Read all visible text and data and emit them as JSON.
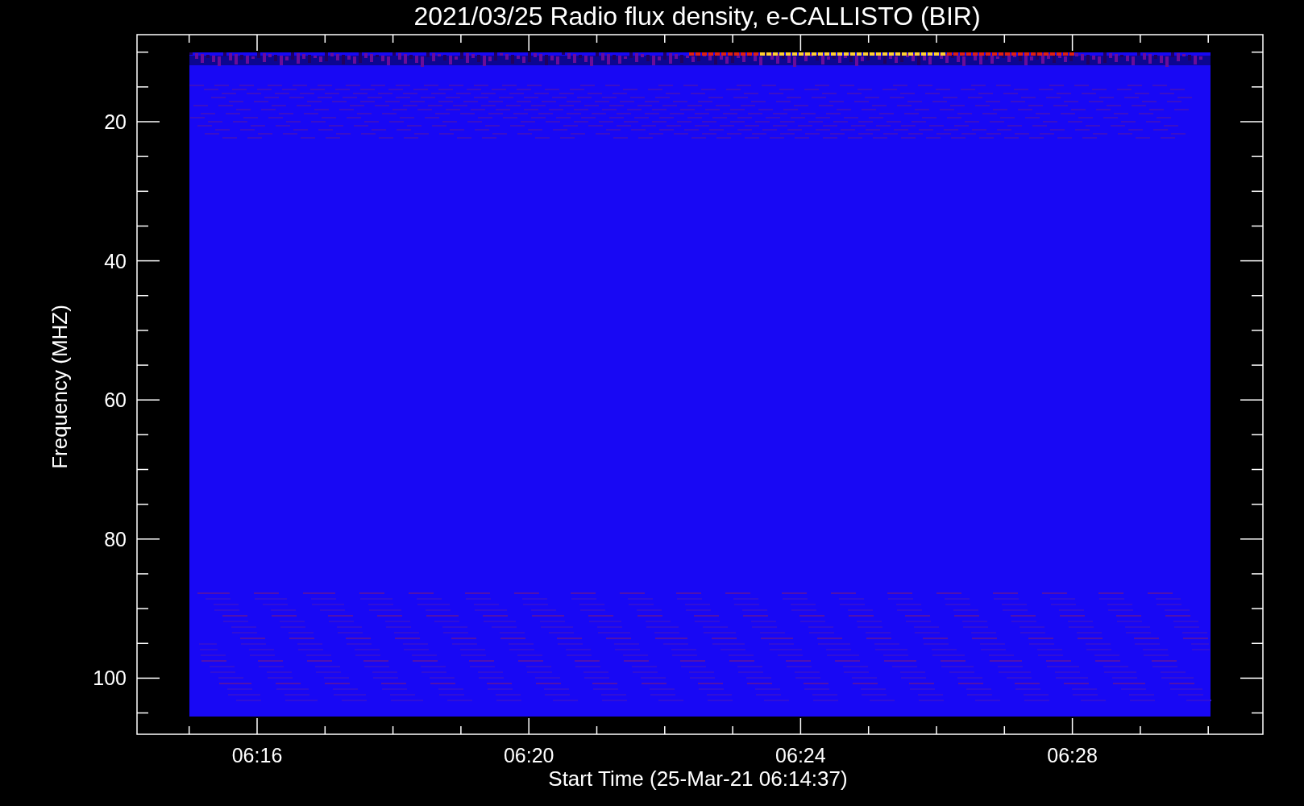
{
  "plot": {
    "title": "2021/03/25  Radio flux density, e-CALLISTO (BIR)",
    "ylabel": "Frequency (MHZ)",
    "xlabel": "Start Time (25-Mar-21 06:14:37)",
    "yticks": [
      "20",
      "40",
      "60",
      "80",
      "100"
    ],
    "xticks": [
      "06:16",
      "06:20",
      "06:24",
      "06:28"
    ]
  }
}
